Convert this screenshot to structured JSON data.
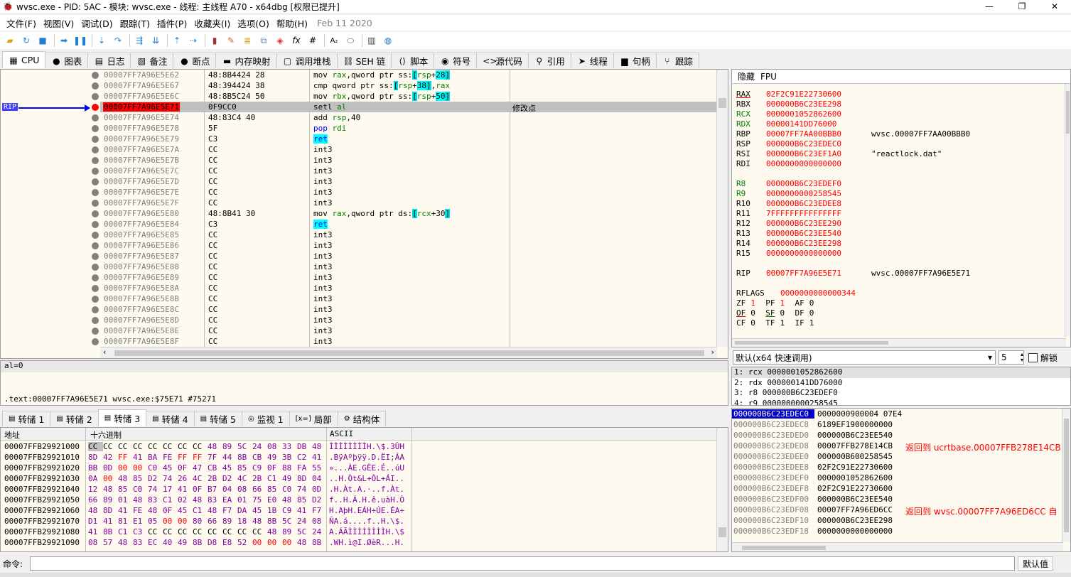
{
  "window": {
    "title": "wvsc.exe - PID: 5AC - 模块: wvsc.exe - 线程: 主线程 A70 - x64dbg [权限已提升]",
    "minimize": "—",
    "maximize": "❐",
    "close": "✕"
  },
  "menu": {
    "items": [
      "文件(F)",
      "视图(V)",
      "调试(D)",
      "跟踪(T)",
      "插件(P)",
      "收藏夹(I)",
      "选项(O)",
      "帮助(H)"
    ],
    "date": "Feb 11 2020"
  },
  "tabs": [
    {
      "label": "CPU",
      "icon": "cpu-icon",
      "glyph": "▦"
    },
    {
      "label": "图表",
      "icon": "graph-icon",
      "glyph": "●"
    },
    {
      "label": "日志",
      "icon": "log-icon",
      "glyph": "▤"
    },
    {
      "label": "备注",
      "icon": "notes-icon",
      "glyph": "▧"
    },
    {
      "label": "断点",
      "icon": "breakpoint-icon",
      "glyph": "●"
    },
    {
      "label": "内存映射",
      "icon": "memory-map-icon",
      "glyph": "▬"
    },
    {
      "label": "调用堆栈",
      "icon": "call-stack-icon",
      "glyph": "▢"
    },
    {
      "label": "SEH 链",
      "icon": "seh-icon",
      "glyph": "⛓"
    },
    {
      "label": "脚本",
      "icon": "script-icon",
      "glyph": "⟨⟩"
    },
    {
      "label": "符号",
      "icon": "symbols-icon",
      "glyph": "◉"
    },
    {
      "label": "源代码",
      "icon": "source-icon",
      "glyph": "<>"
    },
    {
      "label": "引用",
      "icon": "references-icon",
      "glyph": "⚲"
    },
    {
      "label": "线程",
      "icon": "threads-icon",
      "glyph": "➤"
    },
    {
      "label": "句柄",
      "icon": "handles-icon",
      "glyph": "▆"
    },
    {
      "label": "跟踪",
      "icon": "trace-icon",
      "glyph": "⑂"
    }
  ],
  "disasm": {
    "rip_label": "RIP",
    "rows": [
      {
        "addr": "00007FF7A96E5E62",
        "bytes": "48:8B4424 28",
        "instr": "mov rax,qword ptr ss:[rsp+28]",
        "comment": ""
      },
      {
        "addr": "00007FF7A96E5E67",
        "bytes": "48:394424 38",
        "instr": "cmp qword ptr ss:[rsp+38],rax",
        "comment": ""
      },
      {
        "addr": "00007FF7A96E5E6C",
        "bytes": "48:8B5C24 50",
        "instr": "mov rbx,qword ptr ss:[rsp+50]",
        "comment": ""
      },
      {
        "addr": "00007FF7A96E5E71",
        "bytes": "0F9CC0",
        "instr": "setl al",
        "comment": "修改点"
      },
      {
        "addr": "00007FF7A96E5E74",
        "bytes": "48:83C4 40",
        "instr": "add rsp,40",
        "comment": ""
      },
      {
        "addr": "00007FF7A96E5E78",
        "bytes": "5F",
        "instr": "pop rdi",
        "comment": ""
      },
      {
        "addr": "00007FF7A96E5E79",
        "bytes": "C3",
        "instr": "ret",
        "comment": ""
      },
      {
        "addr": "00007FF7A96E5E7A",
        "bytes": "CC",
        "instr": "int3",
        "comment": ""
      },
      {
        "addr": "00007FF7A96E5E7B",
        "bytes": "CC",
        "instr": "int3",
        "comment": ""
      },
      {
        "addr": "00007FF7A96E5E7C",
        "bytes": "CC",
        "instr": "int3",
        "comment": ""
      },
      {
        "addr": "00007FF7A96E5E7D",
        "bytes": "CC",
        "instr": "int3",
        "comment": ""
      },
      {
        "addr": "00007FF7A96E5E7E",
        "bytes": "CC",
        "instr": "int3",
        "comment": ""
      },
      {
        "addr": "00007FF7A96E5E7F",
        "bytes": "CC",
        "instr": "int3",
        "comment": ""
      },
      {
        "addr": "00007FF7A96E5E80",
        "bytes": "48:8B41 30",
        "instr": "mov rax,qword ptr ds:[rcx+30]",
        "comment": ""
      },
      {
        "addr": "00007FF7A96E5E84",
        "bytes": "C3",
        "instr": "ret",
        "comment": ""
      },
      {
        "addr": "00007FF7A96E5E85",
        "bytes": "CC",
        "instr": "int3",
        "comment": ""
      },
      {
        "addr": "00007FF7A96E5E86",
        "bytes": "CC",
        "instr": "int3",
        "comment": ""
      },
      {
        "addr": "00007FF7A96E5E87",
        "bytes": "CC",
        "instr": "int3",
        "comment": ""
      },
      {
        "addr": "00007FF7A96E5E88",
        "bytes": "CC",
        "instr": "int3",
        "comment": ""
      },
      {
        "addr": "00007FF7A96E5E89",
        "bytes": "CC",
        "instr": "int3",
        "comment": ""
      },
      {
        "addr": "00007FF7A96E5E8A",
        "bytes": "CC",
        "instr": "int3",
        "comment": ""
      },
      {
        "addr": "00007FF7A96E5E8B",
        "bytes": "CC",
        "instr": "int3",
        "comment": ""
      },
      {
        "addr": "00007FF7A96E5E8C",
        "bytes": "CC",
        "instr": "int3",
        "comment": ""
      },
      {
        "addr": "00007FF7A96E5E8D",
        "bytes": "CC",
        "instr": "int3",
        "comment": ""
      },
      {
        "addr": "00007FF7A96E5E8E",
        "bytes": "CC",
        "instr": "int3",
        "comment": ""
      },
      {
        "addr": "00007FF7A96E5E8F",
        "bytes": "CC",
        "instr": "int3",
        "comment": ""
      }
    ]
  },
  "registers": {
    "tabs": [
      "隐藏",
      "FPU"
    ],
    "general": [
      {
        "name": "RAX",
        "value": "02F2C91E22730600",
        "comment": ""
      },
      {
        "name": "RBX",
        "value": "000000B6C23EE298",
        "comment": ""
      },
      {
        "name": "RCX",
        "value": "0000001052862600",
        "comment": ""
      },
      {
        "name": "RDX",
        "value": "00000141DD76000",
        "comment": ""
      },
      {
        "name": "RBP",
        "value": "00007FF7AA00BBB0",
        "comment": "wvsc.00007FF7AA00BBB0"
      },
      {
        "name": "RSP",
        "value": "000000B6C23EDEC0",
        "comment": ""
      },
      {
        "name": "RSI",
        "value": "000000B6C23EF1A0",
        "comment": "\"reactlock.dat\""
      },
      {
        "name": "RDI",
        "value": "0000000000000000",
        "comment": ""
      }
    ],
    "extended": [
      {
        "name": "R8",
        "value": "000000B6C23EDEF0",
        "comment": ""
      },
      {
        "name": "R9",
        "value": "0000000000258545",
        "comment": ""
      },
      {
        "name": "R10",
        "value": "000000B6C23EDEE8",
        "comment": ""
      },
      {
        "name": "R11",
        "value": "7FFFFFFFFFFFFFFF",
        "comment": ""
      },
      {
        "name": "R12",
        "value": "000000B6C23EE290",
        "comment": ""
      },
      {
        "name": "R13",
        "value": "000000B6C23EE540",
        "comment": ""
      },
      {
        "name": "R14",
        "value": "000000B6C23EE298",
        "comment": ""
      },
      {
        "name": "R15",
        "value": "0000000000000000",
        "comment": ""
      }
    ],
    "rip": {
      "name": "RIP",
      "value": "00007FF7A96E5E71",
      "comment": "wvsc.00007FF7A96E5E71"
    },
    "rflags": {
      "name": "RFLAGS",
      "value": "0000000000000344"
    },
    "flags": [
      [
        {
          "n": "ZF",
          "v": "1"
        },
        {
          "n": "PF",
          "v": "1"
        },
        {
          "n": "AF",
          "v": "0"
        }
      ],
      [
        {
          "n": "OF",
          "v": "0"
        },
        {
          "n": "SF",
          "v": "0"
        },
        {
          "n": "DF",
          "v": "0"
        }
      ],
      [
        {
          "n": "CF",
          "v": "0"
        },
        {
          "n": "TF",
          "v": "1"
        },
        {
          "n": "IF",
          "v": "1"
        }
      ]
    ]
  },
  "callconv": {
    "selected": "默认(x64 快速调用)",
    "count": "5",
    "unlock_label": "解锁",
    "args": [
      "1: rcx 0000001052862600",
      "2: rdx 000000141DD76000",
      "3: r8 000000B6C23EDEF0",
      "4: r9 0000000000258545"
    ]
  },
  "info": {
    "line1": "al=0",
    "line2": ".text:00007FF7A96E5E71 wvsc.exe:$75E71 #75271"
  },
  "dumptabs": [
    {
      "label": "转储 1",
      "icon": "dump-icon",
      "glyph": "▤"
    },
    {
      "label": "转储 2",
      "icon": "dump-icon",
      "glyph": "▤"
    },
    {
      "label": "转储 3",
      "icon": "dump-icon",
      "glyph": "▤"
    },
    {
      "label": "转储 4",
      "icon": "dump-icon",
      "glyph": "▤"
    },
    {
      "label": "转储 5",
      "icon": "dump-icon",
      "glyph": "▤"
    },
    {
      "label": "监视 1",
      "icon": "watch-icon",
      "glyph": "◎"
    },
    {
      "label": "局部",
      "icon": "locals-icon",
      "glyph": "[x=]"
    },
    {
      "label": "结构体",
      "icon": "struct-icon",
      "glyph": "⚙"
    }
  ],
  "dump": {
    "headers": {
      "addr": "地址",
      "hex": "十六进制",
      "ascii": "ASCII"
    },
    "rows": [
      {
        "addr": "00007FFB29921000",
        "hex": [
          "CC",
          "CC",
          "CC",
          "CC",
          "CC",
          "CC",
          "CC",
          "CC",
          "48",
          "89",
          "5C",
          "24",
          "08",
          "33",
          "DB",
          "48"
        ],
        "ascii": "ÌÌÌÌÌÌÌÌH.\\$.3ÛH"
      },
      {
        "addr": "00007FFB29921010",
        "hex": [
          "8D",
          "42",
          "FF",
          "41",
          "BA",
          "FE",
          "FF",
          "FF",
          "7F",
          "44",
          "8B",
          "CB",
          "49",
          "3B",
          "C2",
          "41"
        ],
        "ascii": ".BÿAºþÿÿ.D.ËI;ÂA"
      },
      {
        "addr": "00007FFB29921020",
        "hex": [
          "BB",
          "0D",
          "00",
          "00",
          "C0",
          "45",
          "0F",
          "47",
          "CB",
          "45",
          "85",
          "C9",
          "0F",
          "88",
          "FA",
          "55"
        ],
        "ascii": "»...ÀE.GËE.É..úU"
      },
      {
        "addr": "00007FFB29921030",
        "hex": [
          "0A",
          "00",
          "48",
          "85",
          "D2",
          "74",
          "26",
          "4C",
          "2B",
          "D2",
          "4C",
          "2B",
          "C1",
          "49",
          "8D",
          "04"
        ],
        "ascii": "..H.Òt&L+ÒL+ÁI.."
      },
      {
        "addr": "00007FFB29921040",
        "hex": [
          "12",
          "48",
          "85",
          "C0",
          "74",
          "17",
          "41",
          "0F",
          "B7",
          "04",
          "08",
          "66",
          "85",
          "C0",
          "74",
          "0D"
        ],
        "ascii": ".H.Àt.A.·..f.Àt."
      },
      {
        "addr": "00007FFB29921050",
        "hex": [
          "66",
          "89",
          "01",
          "48",
          "83",
          "C1",
          "02",
          "48",
          "83",
          "EA",
          "01",
          "75",
          "E0",
          "48",
          "85",
          "D2"
        ],
        "ascii": "f..H.Á.H.ê.uàH.Ò"
      },
      {
        "addr": "00007FFB29921060",
        "hex": [
          "48",
          "8D",
          "41",
          "FE",
          "48",
          "0F",
          "45",
          "C1",
          "48",
          "F7",
          "DA",
          "45",
          "1B",
          "C9",
          "41",
          "F7"
        ],
        "ascii": "H.AþH.EÁH÷ÚE.ÉA÷"
      },
      {
        "addr": "00007FFB29921070",
        "hex": [
          "D1",
          "41",
          "81",
          "E1",
          "05",
          "00",
          "00",
          "80",
          "66",
          "89",
          "18",
          "48",
          "8B",
          "5C",
          "24",
          "08"
        ],
        "ascii": "ÑA.á....f..H.\\$."
      },
      {
        "addr": "00007FFB29921080",
        "hex": [
          "41",
          "8B",
          "C1",
          "C3",
          "CC",
          "CC",
          "CC",
          "CC",
          "CC",
          "CC",
          "CC",
          "CC",
          "48",
          "89",
          "5C",
          "24"
        ],
        "ascii": "A.ÁÃÌÌÌÌÌÌÌÌH.\\$"
      },
      {
        "addr": "00007FFB29921090",
        "hex": [
          "08",
          "57",
          "48",
          "83",
          "EC",
          "40",
          "49",
          "8B",
          "D8",
          "E8",
          "52",
          "00",
          "00",
          "00",
          "48",
          "8B"
        ],
        "ascii": ".WH.ì@I.ØèR...H."
      }
    ]
  },
  "stack": {
    "rows": [
      {
        "addr": "000000B6C23EDEC0",
        "val": "0000000900004 07E4",
        "comment": ""
      },
      {
        "addr": "000000B6C23EDEC8",
        "val": "6189EF1900000000",
        "comment": ""
      },
      {
        "addr": "000000B6C23EDED0",
        "val": "000000B6C23EE540",
        "comment": ""
      },
      {
        "addr": "000000B6C23EDED8",
        "val": "00007FFB278E14CB",
        "comment": "返回到 ucrtbase.00007FFB278E14CB"
      },
      {
        "addr": "000000B6C23EDEE0",
        "val": "000000B600258545",
        "comment": ""
      },
      {
        "addr": "000000B6C23EDEE8",
        "val": "02F2C91E22730600",
        "comment": ""
      },
      {
        "addr": "000000B6C23EDEF0",
        "val": "0000001052862600",
        "comment": ""
      },
      {
        "addr": "000000B6C23EDEF8",
        "val": "02F2C91E22730600",
        "comment": ""
      },
      {
        "addr": "000000B6C23EDF00",
        "val": "000000B6C23EE540",
        "comment": ""
      },
      {
        "addr": "000000B6C23EDF08",
        "val": "00007FF7A96ED6CC",
        "comment": "返回到 wvsc.00007FF7A96ED6CC 自"
      },
      {
        "addr": "000000B6C23EDF10",
        "val": "000000B6C23EE298",
        "comment": ""
      },
      {
        "addr": "000000B6C23EDF18",
        "val": "0000000000000000",
        "comment": ""
      }
    ]
  },
  "command": {
    "label": "命令:",
    "value": "",
    "default_btn": "默认值"
  }
}
